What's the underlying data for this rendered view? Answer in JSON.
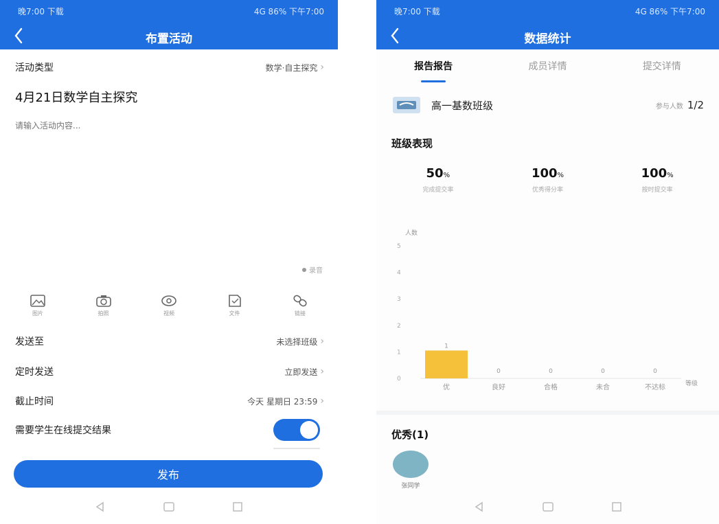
{
  "left": {
    "status_left": "晚7:00 下载",
    "status_right": "4G 86% 下午7:00",
    "title": "布置活动",
    "activity_type_label": "活动类型",
    "activity_type_value": "数学·自主探究",
    "heading": "4月21日数学自主探究",
    "input_placeholder": "请输入活动内容...",
    "record_label": "录音",
    "tools": [
      {
        "icon": "image-icon",
        "label": "图片"
      },
      {
        "icon": "camera-icon",
        "label": "拍照"
      },
      {
        "icon": "video-icon",
        "label": "视频"
      },
      {
        "icon": "file-icon",
        "label": "文件"
      },
      {
        "icon": "link-icon",
        "label": "链接"
      }
    ],
    "rows": [
      {
        "label": "发送至",
        "value": "未选择班级"
      },
      {
        "label": "定时发送",
        "value": "立即发送"
      },
      {
        "label": "截止时间",
        "value": "今天 星期日 23:59"
      }
    ],
    "toggle_label": "需要学生在线提交结果",
    "toggle_on": true,
    "publish_label": "发布"
  },
  "right": {
    "status_left": "晚7:00 下载",
    "status_right": "4G 86% 下午7:00",
    "title": "数据统计",
    "tabs": [
      "报告报告",
      "成员详情",
      "提交详情"
    ],
    "class_name": "高一基数班级",
    "class_count_label": "参与人数",
    "class_count": "1/2",
    "section_title": "班级表现",
    "stats": [
      {
        "value": "50",
        "unit": "%",
        "caption": "完成提交率"
      },
      {
        "value": "100",
        "unit": "%",
        "caption": "优秀得分率"
      },
      {
        "value": "100",
        "unit": "%",
        "caption": "按时提交率"
      }
    ],
    "excellent_title": "优秀(1)",
    "excellent_name": "张同学",
    "accent": "#1f6fe0",
    "bar_color": "#f5c03a"
  },
  "chart_data": {
    "type": "bar",
    "ylabel": "人数",
    "xlabel": "等级",
    "categories": [
      "优",
      "良好",
      "合格",
      "未合",
      "不达标"
    ],
    "values": [
      1,
      0,
      0,
      0,
      0
    ],
    "y_ticks": [
      0,
      1,
      2,
      3,
      4,
      5
    ],
    "ylim": [
      0,
      5
    ],
    "grid": false
  }
}
